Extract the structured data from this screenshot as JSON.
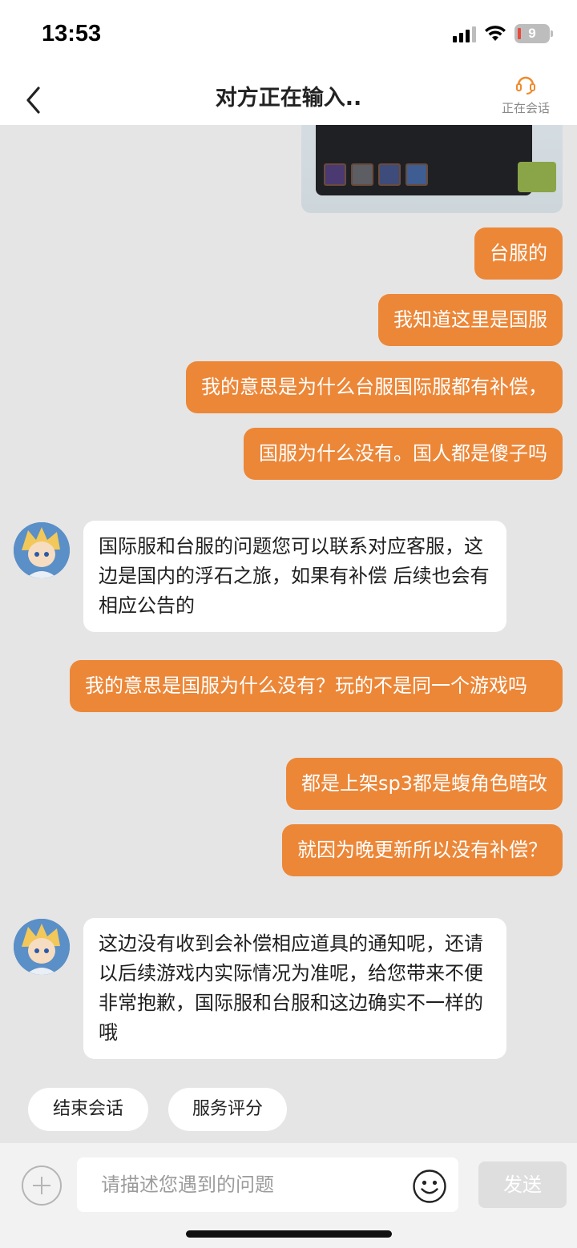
{
  "status_bar": {
    "time": "13:53",
    "battery": "9"
  },
  "header": {
    "title": "对方正在输入..",
    "session_status": "正在会话"
  },
  "messages": [
    {
      "from": "user",
      "text": "台服的"
    },
    {
      "from": "user",
      "text": "我知道这里是国服"
    },
    {
      "from": "user",
      "text": "我的意思是为什么台服国际服都有补偿，"
    },
    {
      "from": "user",
      "text": "国服为什么没有。国人都是傻子吗"
    },
    {
      "from": "agent",
      "text": "国际服和台服的问题您可以联系对应客服，这边是国内的浮石之旅，如果有补偿 后续也会有相应公告的"
    },
    {
      "from": "user",
      "text": "我的意思是国服为什么没有？玩的不是同一个游戏吗"
    },
    {
      "from": "user",
      "text": "都是上架sp3都是蝮角色暗改"
    },
    {
      "from": "user",
      "text": "就因为晚更新所以没有补偿？"
    },
    {
      "from": "agent",
      "text": "这边没有收到会补偿相应道具的通知呢，还请以后续游戏内实际情况为准呢，给您带来不便非常抱歉，国际服和台服和这边确实不一样的哦"
    }
  ],
  "quick_actions": {
    "end_session": "结束会话",
    "rate_service": "服务评分"
  },
  "input": {
    "placeholder": "请描述您遇到的问题",
    "send_label": "发送"
  },
  "colors": {
    "user_bubble": "#ec8738",
    "accent": "#f08a2c"
  },
  "icons": [
    "back-arrow-icon",
    "headset-icon",
    "plus-icon",
    "emoji-icon",
    "signal-icon",
    "wifi-icon",
    "battery-icon"
  ]
}
